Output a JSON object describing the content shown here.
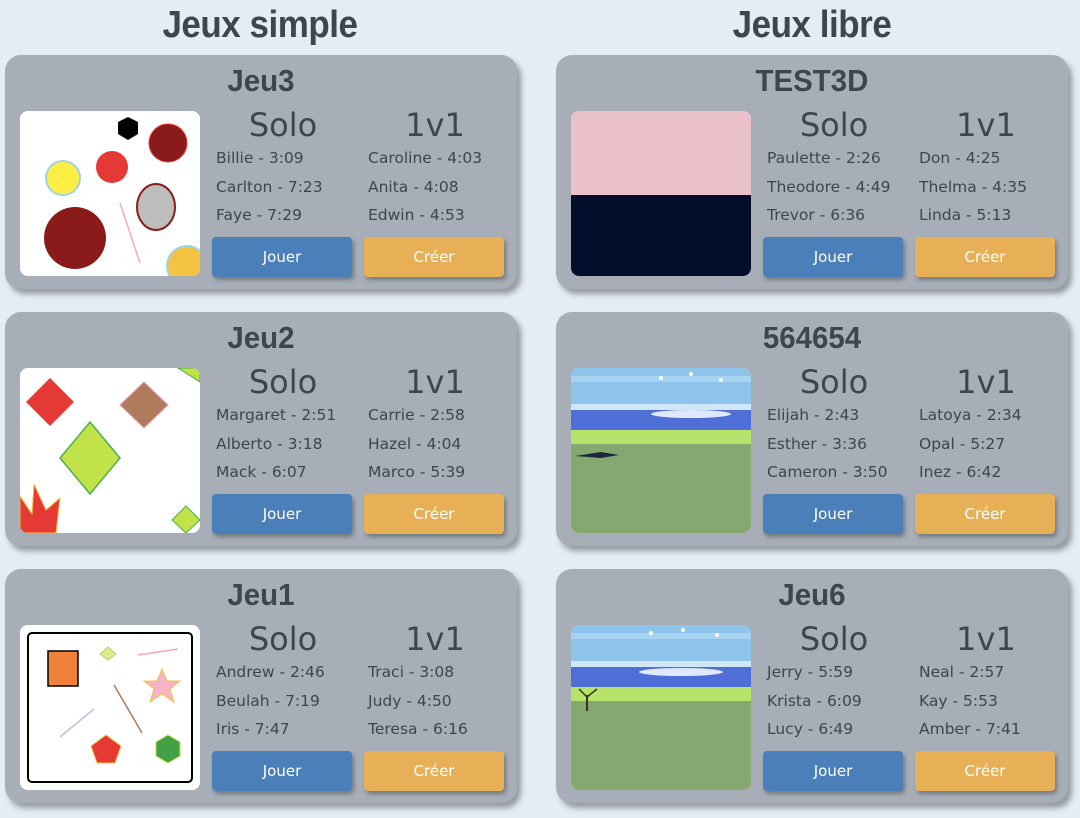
{
  "sections": [
    {
      "title": "Jeux simple"
    },
    {
      "title": "Jeux libre"
    }
  ],
  "games": [
    {
      "title": "Jeu3",
      "thumb": "shapes-circles",
      "solo_label": "Solo",
      "duel_label": "1v1",
      "solo": [
        "Billie - 3:09",
        "Carlton - 7:23",
        "Faye - 7:29"
      ],
      "duel": [
        "Caroline - 4:03",
        "Anita - 4:08",
        "Edwin - 4:53"
      ],
      "play_label": "Jouer",
      "create_label": "Créer"
    },
    {
      "title": "TEST3D",
      "thumb": "pink-navy",
      "solo_label": "Solo",
      "duel_label": "1v1",
      "solo": [
        "Paulette - 2:26",
        "Theodore - 4:49",
        "Trevor - 6:36"
      ],
      "duel": [
        "Don - 4:25",
        "Thelma - 4:35",
        "Linda - 5:13"
      ],
      "play_label": "Jouer",
      "create_label": "Créer"
    },
    {
      "title": "Jeu2",
      "thumb": "shapes-diamonds",
      "solo_label": "Solo",
      "duel_label": "1v1",
      "solo": [
        "Margaret - 2:51",
        "Alberto - 3:18",
        "Mack - 6:07"
      ],
      "duel": [
        "Carrie - 2:58",
        "Hazel - 4:04",
        "Marco - 5:39"
      ],
      "play_label": "Jouer",
      "create_label": "Créer"
    },
    {
      "title": "564654",
      "thumb": "landscape-plane",
      "solo_label": "Solo",
      "duel_label": "1v1",
      "solo": [
        "Elijah - 2:43",
        "Esther - 3:36",
        "Cameron - 3:50"
      ],
      "duel": [
        "Latoya - 2:34",
        "Opal - 5:27",
        "Inez - 6:42"
      ],
      "play_label": "Jouer",
      "create_label": "Créer"
    },
    {
      "title": "Jeu1",
      "thumb": "shapes-polygons",
      "solo_label": "Solo",
      "duel_label": "1v1",
      "solo": [
        "Andrew - 2:46",
        "Beulah - 7:19",
        "Iris - 7:47"
      ],
      "duel": [
        "Traci - 3:08",
        "Judy - 4:50",
        "Teresa - 6:16"
      ],
      "play_label": "Jouer",
      "create_label": "Créer"
    },
    {
      "title": "Jeu6",
      "thumb": "landscape-tree",
      "solo_label": "Solo",
      "duel_label": "1v1",
      "solo": [
        "Jerry - 5:59",
        "Krista - 6:09",
        "Lucy - 6:49"
      ],
      "duel": [
        "Neal - 2:57",
        "Kay - 5:53",
        "Amber - 7:41"
      ],
      "play_label": "Jouer",
      "create_label": "Créer"
    }
  ],
  "colors": {
    "card": "#a7aeb8",
    "play": "#4a7fb9",
    "create": "#e8b056",
    "text": "#40444f"
  }
}
